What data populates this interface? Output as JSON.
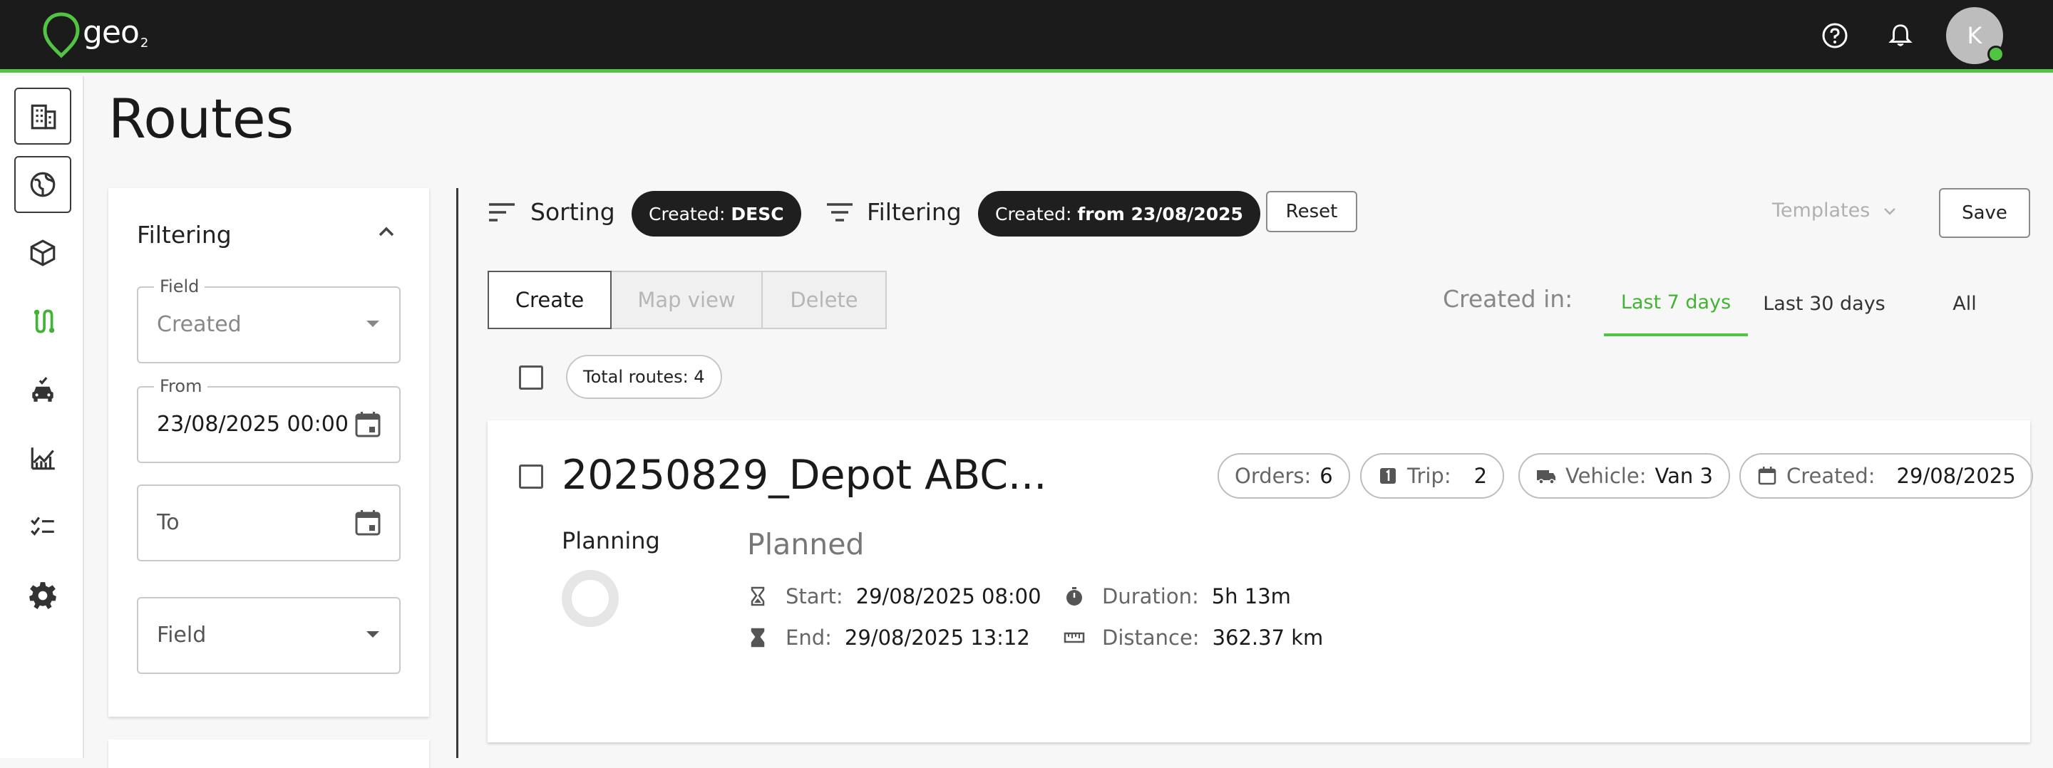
{
  "brand": {
    "logo_text": "geo",
    "logo_sub": "2",
    "accent": "#52c443"
  },
  "topbar": {
    "help_icon": "help-circle-icon",
    "bell_icon": "bell-icon",
    "avatar_initial": "K"
  },
  "sidenav": {
    "items": [
      "buildings-icon",
      "globe-icon",
      "package-icon",
      "route-icon",
      "car-check-icon",
      "chart-line-icon",
      "checklist-icon",
      "gear-icon"
    ]
  },
  "page": {
    "title": "Routes"
  },
  "filter_panel": {
    "title": "Filtering",
    "field1": {
      "label": "Field",
      "value": "Created"
    },
    "from": {
      "label": "From",
      "value": "23/08/2025 00:00"
    },
    "to": {
      "placeholder": "To"
    },
    "field2": {
      "placeholder": "Field"
    }
  },
  "toolbar": {
    "sorting_label": "Sorting",
    "sorting_chip_key": "Created:",
    "sorting_chip_value": "DESC",
    "filtering_label": "Filtering",
    "filtering_chip_key": "Created:",
    "filtering_chip_value": "from 23/08/2025",
    "reset_label": "Reset",
    "templates_label": "Templates",
    "save_label": "Save"
  },
  "actions": {
    "create": "Create",
    "map_view": "Map view",
    "delete": "Delete"
  },
  "created_in": {
    "label": "Created in:",
    "tabs": [
      "Last 7 days",
      "Last 30 days",
      "All"
    ],
    "active": "Last 7 days"
  },
  "total_routes": "Total routes: 4",
  "route": {
    "name": "20250829_Depot ABC...",
    "orders_key": "Orders:",
    "orders_val": "6",
    "trip_key": "Trip:",
    "trip_val": "2",
    "vehicle_key": "Vehicle:",
    "vehicle_val": "Van 3",
    "created_key": "Created:",
    "created_val": "29/08/2025",
    "planning_label": "Planning",
    "status": "Planned",
    "start_key": "Start:",
    "start_val": "29/08/2025 08:00",
    "end_key": "End:",
    "end_val": "29/08/2025 13:12",
    "duration_key": "Duration:",
    "duration_val": "5h 13m",
    "distance_key": "Distance:",
    "distance_val": "362.37 km"
  }
}
